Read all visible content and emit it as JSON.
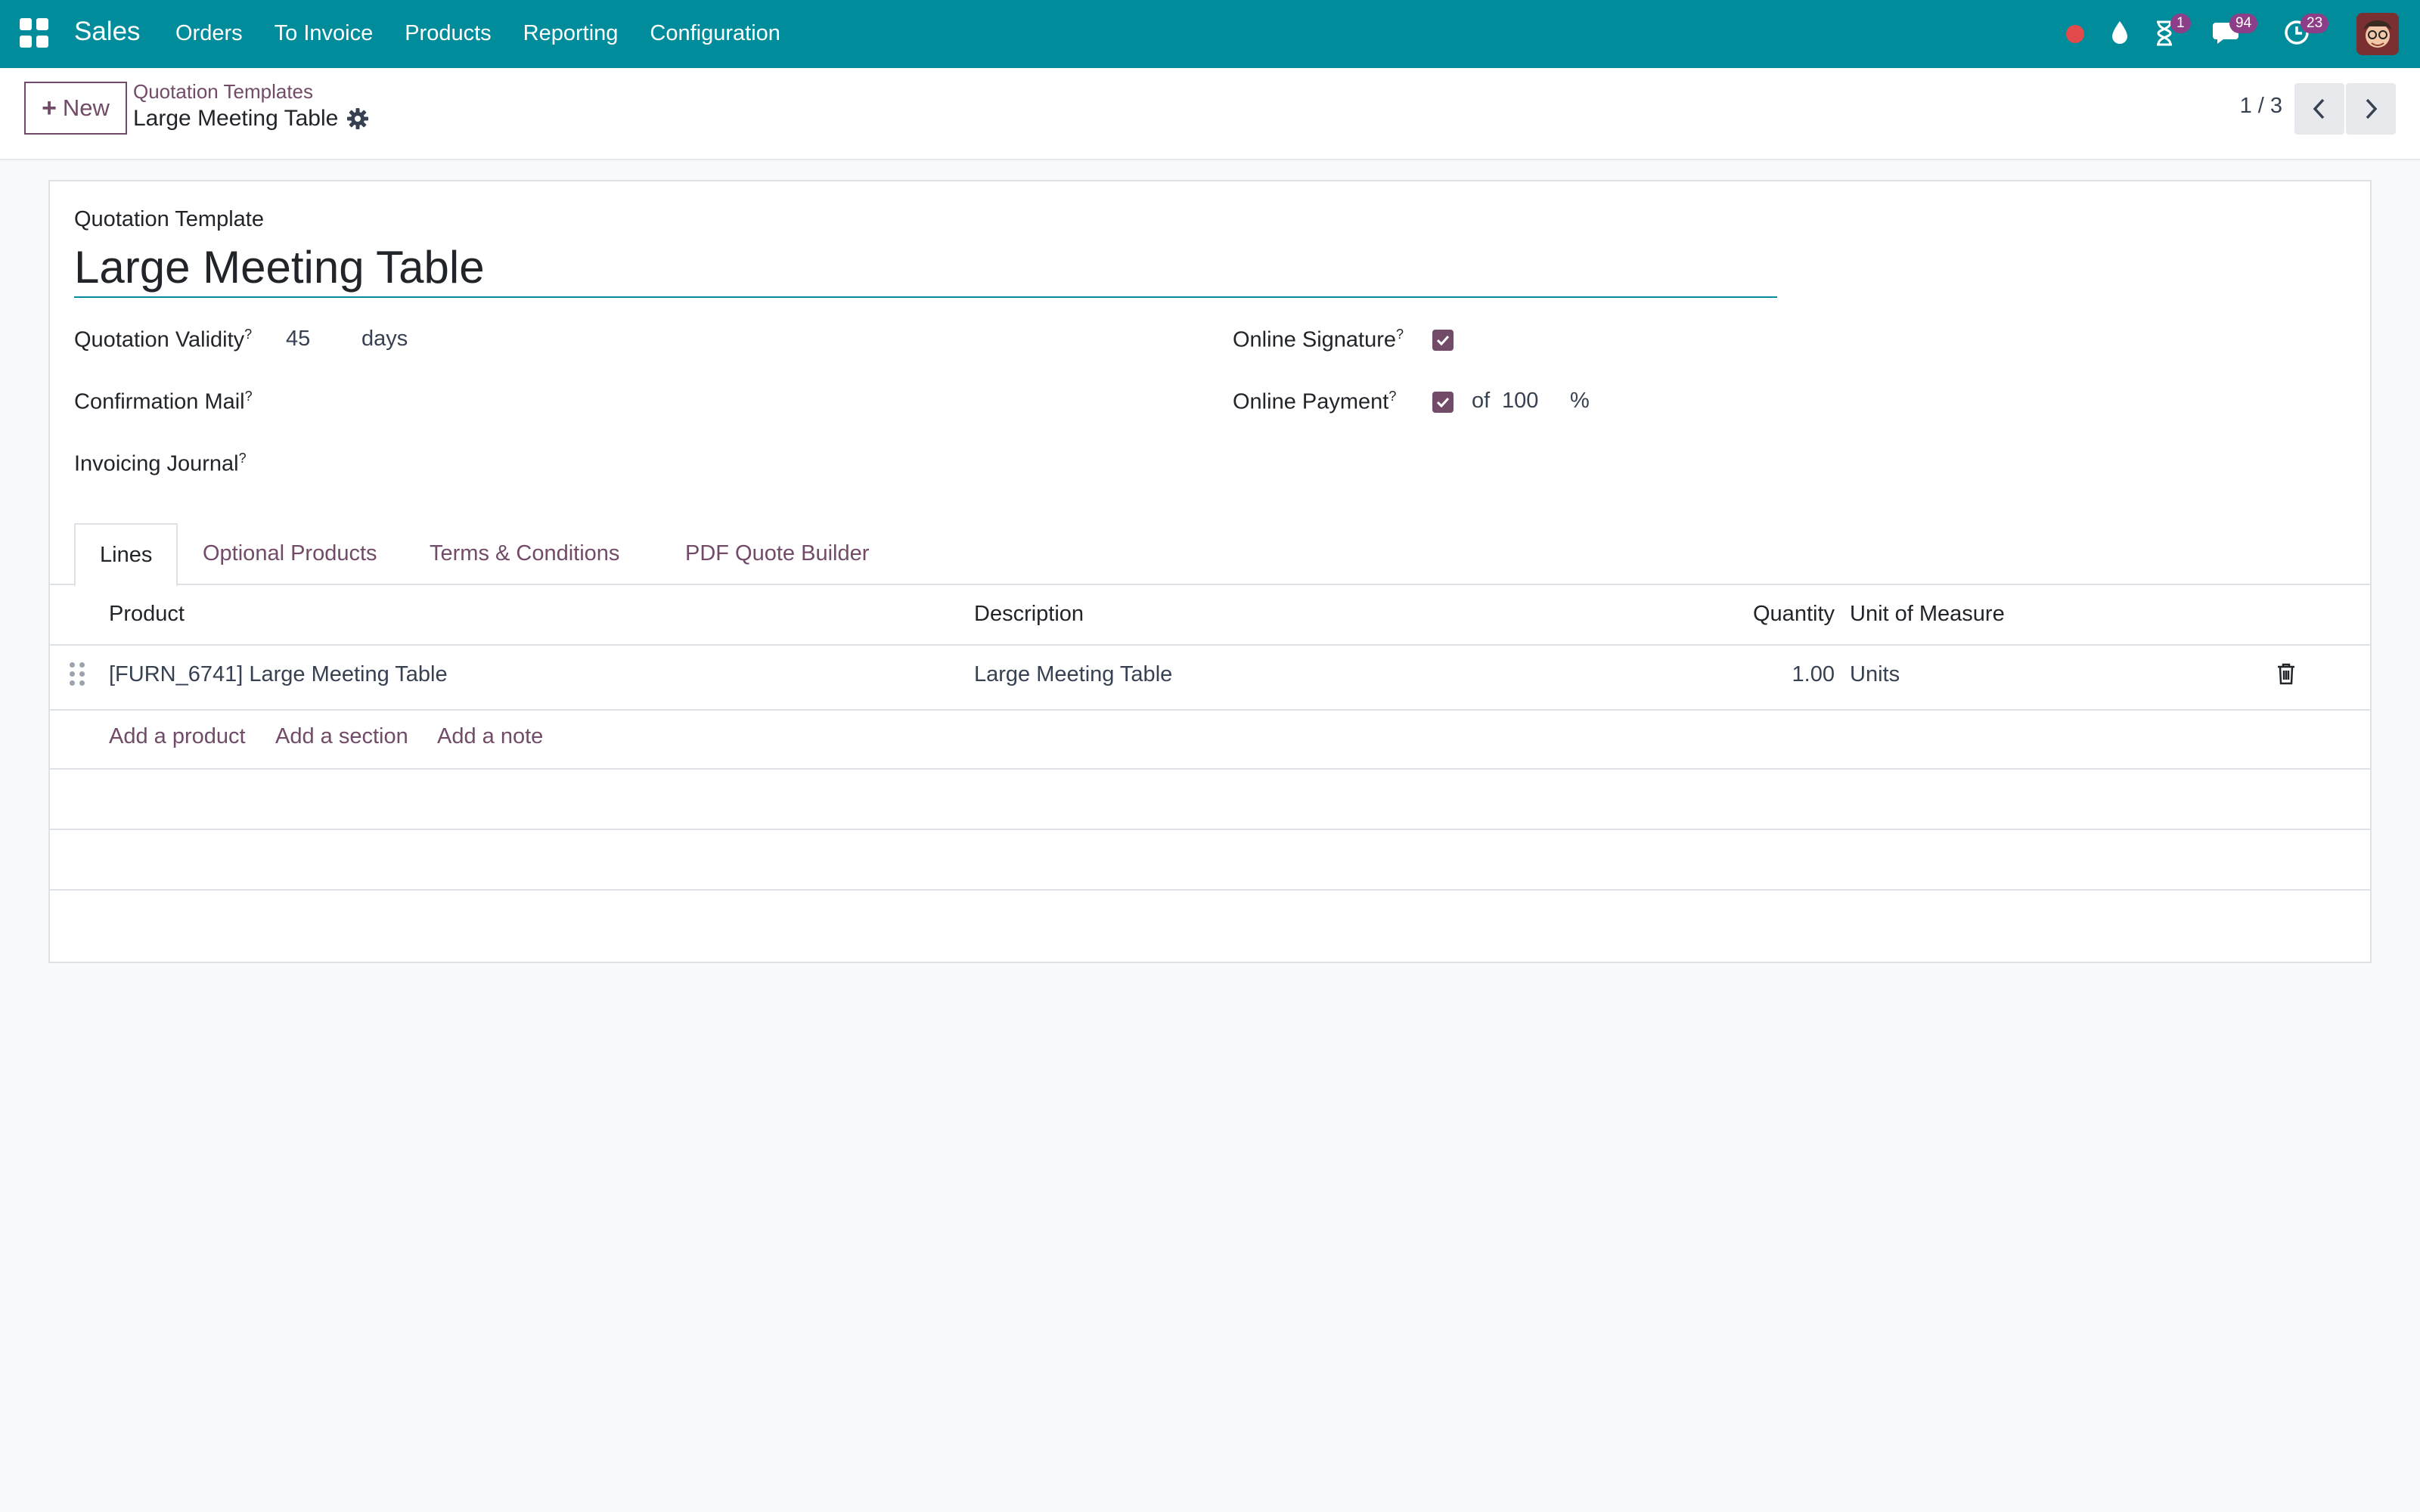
{
  "navbar": {
    "app_name": "Sales",
    "menu": [
      {
        "label": "Orders"
      },
      {
        "label": "To Invoice"
      },
      {
        "label": "Products"
      },
      {
        "label": "Reporting"
      },
      {
        "label": "Configuration"
      }
    ],
    "badges": {
      "activity": "1",
      "messages": "94",
      "clock": "23"
    }
  },
  "control_panel": {
    "new_label": "New",
    "breadcrumb_parent": "Quotation Templates",
    "breadcrumb_current": "Large Meeting Table",
    "pager": "1 / 3"
  },
  "form": {
    "template_label": "Quotation Template",
    "name": "Large Meeting Table",
    "validity_label": "Quotation Validity",
    "validity_value": "45",
    "validity_unit": "days",
    "confirmation_mail_label": "Confirmation Mail",
    "invoicing_journal_label": "Invoicing Journal",
    "online_signature_label": "Online Signature",
    "online_payment_label": "Online Payment",
    "payment_of": "of",
    "payment_value": "100",
    "payment_unit": "%",
    "help_mark": "?"
  },
  "tabs": [
    {
      "label": "Lines"
    },
    {
      "label": "Optional Products"
    },
    {
      "label": "Terms & Conditions"
    },
    {
      "label": "PDF Quote Builder"
    }
  ],
  "lines_table": {
    "columns": [
      "Product",
      "Description",
      "Quantity",
      "Unit of Measure"
    ],
    "rows": [
      {
        "product": "[FURN_6741] Large Meeting Table",
        "description": "Large Meeting Table",
        "quantity": "1.00",
        "uom": "Units"
      }
    ],
    "actions": [
      "Add a product",
      "Add a section",
      "Add a note"
    ]
  },
  "colors": {
    "navbar": "#018c9c",
    "accent": "#714b67",
    "badge": "#8c3f88"
  }
}
